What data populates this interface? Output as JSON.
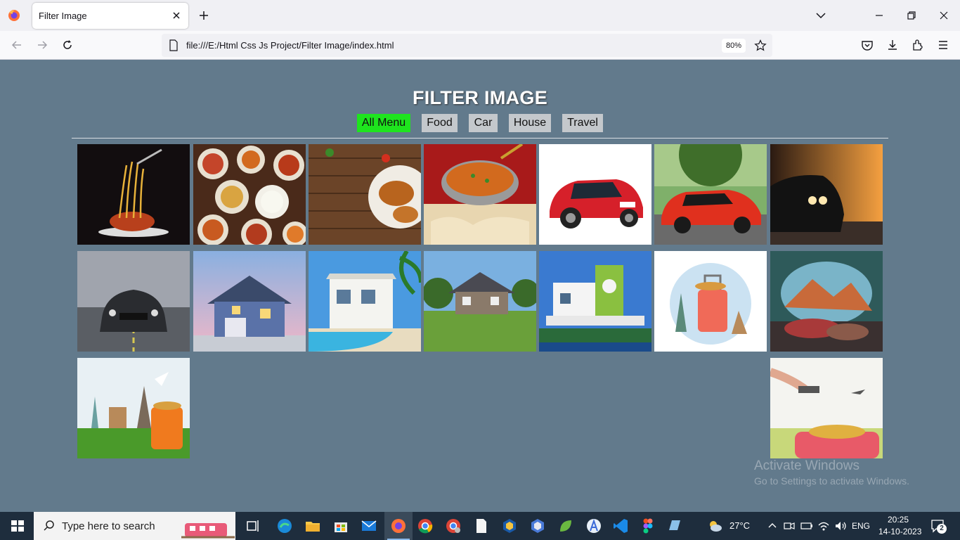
{
  "browser": {
    "tab_title": "Filter Image",
    "url": "file:///E:/Html Css Js Project/Filter Image/index.html",
    "zoom": "80%"
  },
  "page": {
    "title": "FILTER IMAGE",
    "filters": [
      "All Menu",
      "Food",
      "Car",
      "House",
      "Travel"
    ],
    "active_filter": "All Menu",
    "active_color": "#1ee41e",
    "gallery": [
      {
        "category": "food",
        "subject": "spaghetti-fork"
      },
      {
        "category": "food",
        "subject": "indian-food-spread"
      },
      {
        "category": "food",
        "subject": "roast-chicken-board"
      },
      {
        "category": "food",
        "subject": "curry-bowl-naan"
      },
      {
        "category": "car",
        "subject": "red-hatchback"
      },
      {
        "category": "car",
        "subject": "red-sports-car"
      },
      {
        "category": "car",
        "subject": "black-car-sunset"
      },
      {
        "category": "car",
        "subject": "black-mustang"
      },
      {
        "category": "house",
        "subject": "blue-house-dusk"
      },
      {
        "category": "house",
        "subject": "white-villa-pool"
      },
      {
        "category": "house",
        "subject": "suburban-house-lawn"
      },
      {
        "category": "house",
        "subject": "green-modern-house"
      },
      {
        "category": "travel",
        "subject": "suitcase-landmarks"
      },
      {
        "category": "travel",
        "subject": "tent-mountain-view"
      },
      {
        "category": "travel",
        "subject": "world-landmarks-suitcase"
      },
      {
        "category": "travel",
        "subject": "hand-suitcase-hat"
      }
    ]
  },
  "watermark": {
    "line1": "Activate Windows",
    "line2": "Go to Settings to activate Windows."
  },
  "taskbar": {
    "search_placeholder": "Type here to search",
    "weather": "27°C",
    "language": "ENG",
    "time": "20:25",
    "date": "14-10-2023",
    "notifications": "2"
  }
}
